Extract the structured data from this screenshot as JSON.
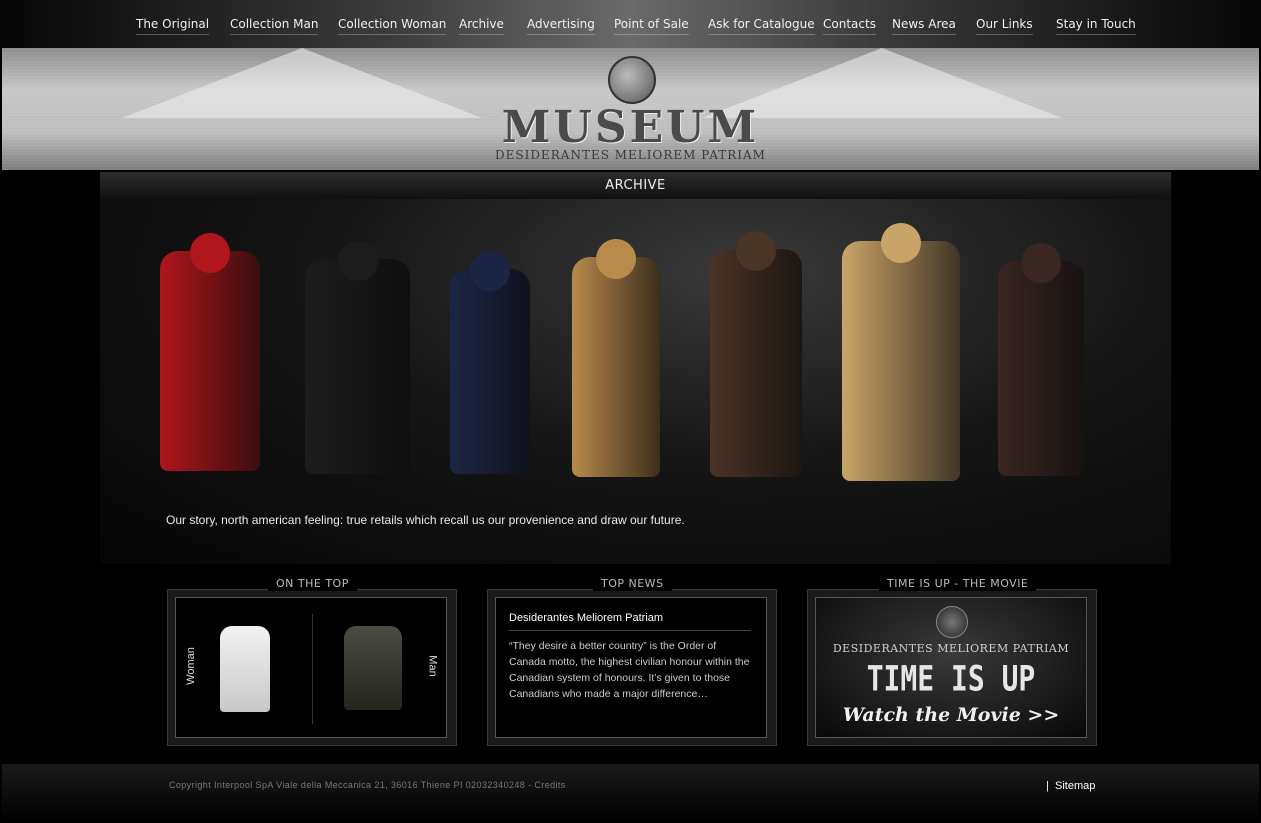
{
  "nav": {
    "items": [
      "The Original",
      "Collection Man",
      "Collection Woman",
      "Archive",
      "Advertising",
      "Point of Sale",
      "Ask for Catalogue",
      "Contacts",
      "News Area",
      "Our Links",
      "Stay in Touch"
    ]
  },
  "logo": {
    "word": "MUSEUM",
    "motto": "DESIDERANTES MELIOREM PATRIAM"
  },
  "section": {
    "title": "ARCHIVE"
  },
  "hero": {
    "tagline": "Our story, north american feeling: true retails which recall us our provenience and draw our future.",
    "jacket_colors": [
      "#b0161c",
      "#1c1c1c",
      "#1d2547",
      "#b88a4b",
      "#4a3426",
      "#c9a468",
      "#3a2622"
    ]
  },
  "boxes": {
    "on_top": {
      "title": "ON THE TOP",
      "woman_label": "Woman",
      "man_label": "Man"
    },
    "top_news": {
      "title": "TOP NEWS",
      "headline": "Desiderantes Meliorem Patriam",
      "body": "“They desire a better country” is the Order of Canada motto, the highest civilian honour within the Canadian system of honours. It’s given to those Canadians who made a major difference…"
    },
    "movie": {
      "title": "TIME IS UP - THE MOVIE",
      "motto": "DESIDERANTES MELIOREM PATRIAM",
      "headline": "TIME IS UP",
      "link": "Watch the Movie >>"
    }
  },
  "footer": {
    "copyright": "Copyright Interpool SpA Viale della Meccanica 21, 36016 Thiene PI 02032340248 - Credits",
    "sitemap": "Sitemap",
    "separator": "|"
  }
}
